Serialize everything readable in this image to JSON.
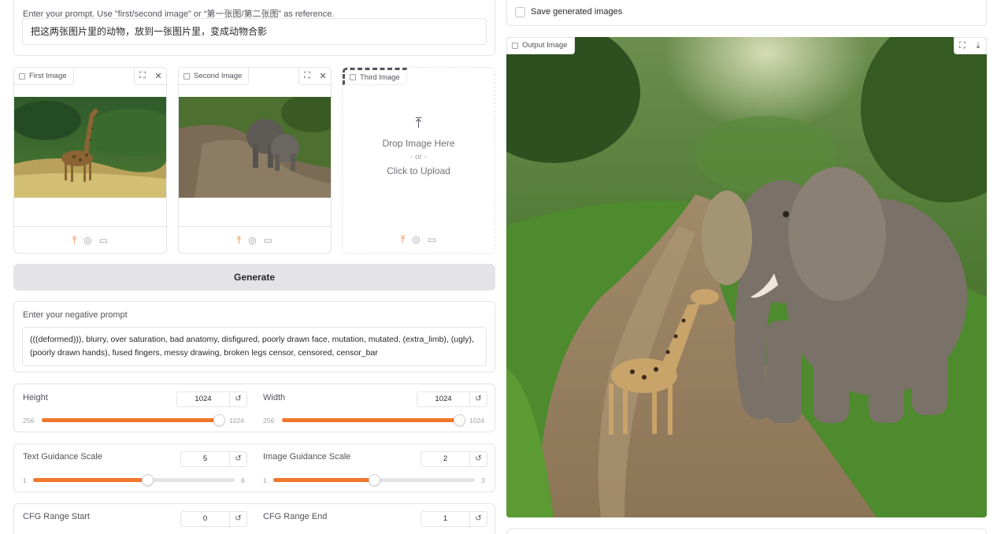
{
  "prompt": {
    "label": "Enter your prompt. Use \"first/second image\" or “第一张图/第二张图” as reference.",
    "value": "把这两张图片里的动物，放到一张图片里，变成动物合影"
  },
  "images": [
    {
      "label": "First Image"
    },
    {
      "label": "Second Image"
    },
    {
      "label": "Third Image",
      "drop_text": "Drop Image Here",
      "or_text": "- or -",
      "upload_text": "Click to Upload"
    }
  ],
  "generate_label": "Generate",
  "negative": {
    "label": "Enter your negative prompt",
    "value": "(((deformed))), blurry, over saturation, bad anatomy, disfigured, poorly drawn face, mutation, mutated, (extra_limb), (ugly), (poorly drawn hands), fused fingers, messy drawing, broken legs censor, censored, censor_bar"
  },
  "sliders": {
    "height": {
      "label": "Height",
      "value": "1024",
      "min": "256",
      "max": "1024",
      "fraction": 1.0
    },
    "width": {
      "label": "Width",
      "value": "1024",
      "min": "256",
      "max": "1024",
      "fraction": 1.0
    },
    "text_guidance": {
      "label": "Text Guidance Scale",
      "value": "5",
      "min": "1",
      "max": "8",
      "fraction": 0.571
    },
    "image_guidance": {
      "label": "Image Guidance Scale",
      "value": "2",
      "min": "1",
      "max": "3",
      "fraction": 0.5
    },
    "cfg_start": {
      "label": "CFG Range Start",
      "value": "0"
    },
    "cfg_end": {
      "label": "CFG Range End",
      "value": "1"
    }
  },
  "save_images_label": "Save generated images",
  "output_label": "Output Image",
  "icons": {
    "upload": "upload-icon",
    "webcam": "webcam-icon",
    "clipboard": "clipboard-icon",
    "fullscreen": "fullscreen-icon",
    "close": "close-icon",
    "reset": "reset-icon",
    "download": "download-icon"
  },
  "colors": {
    "accent": "#f0762b",
    "button_bg": "#e4e4e7",
    "border": "#e4e4e7"
  }
}
